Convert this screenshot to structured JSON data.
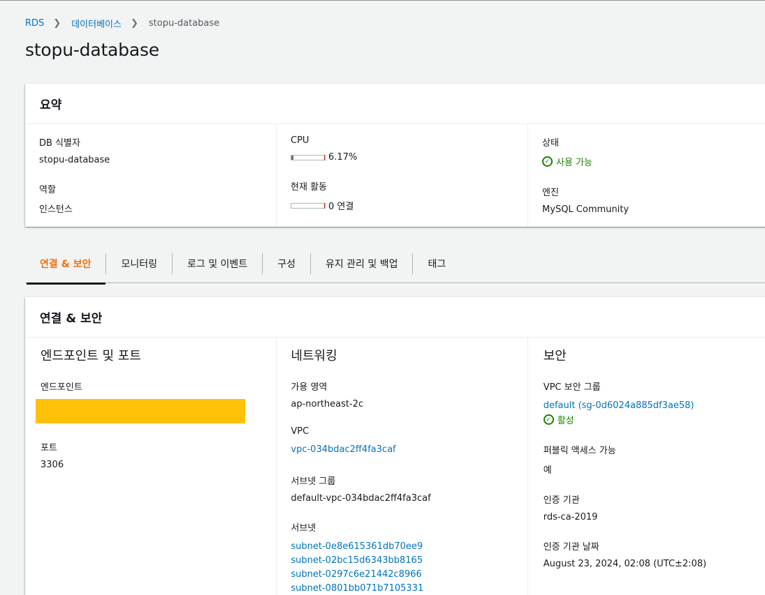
{
  "breadcrumb": {
    "rds": "RDS",
    "databases": "데이터베이스",
    "current": "stopu-database"
  },
  "page_title": "stopu-database",
  "summary": {
    "title": "요약",
    "db_id_label": "DB 식별자",
    "db_id_value": "stopu-database",
    "role_label": "역할",
    "role_value": "인스턴스",
    "cpu_label": "CPU",
    "cpu_value": "6.17%",
    "cpu_fraction": 0.0617,
    "activity_label": "현재 활동",
    "activity_value": "0 연결",
    "status_label": "상태",
    "status_value": "사용 가능",
    "engine_label": "엔진",
    "engine_value": "MySQL Community"
  },
  "tabs": [
    "연결 & 보안",
    "모니터링",
    "로그 및 이벤트",
    "구성",
    "유지 관리 및 백업",
    "태그"
  ],
  "connectivity": {
    "title": "연결 & 보안",
    "endpoint_section": "엔드포인트 및 포트",
    "endpoint_label": "엔드포인트",
    "port_label": "포트",
    "port_value": "3306",
    "networking_section": "네트워킹",
    "az_label": "가용 영역",
    "az_value": "ap-northeast-2c",
    "vpc_label": "VPC",
    "vpc_value": "vpc-034bdac2ff4fa3caf",
    "subnet_group_label": "서브넷 그룹",
    "subnet_group_value": "default-vpc-034bdac2ff4fa3caf",
    "subnets_label": "서브넷",
    "subnets": [
      "subnet-0e8e615361db70ee9",
      "subnet-02bc15d6343bb8165",
      "subnet-0297c6e21442c8966",
      "subnet-0801bb071b7105331"
    ],
    "security_section": "보안",
    "sg_label": "VPC 보안 그룹",
    "sg_value": "default (sg-0d6024a885df3ae58)",
    "sg_status": "활성",
    "public_label": "퍼블릭 액세스 가능",
    "public_value": "예",
    "ca_label": "인증 기관",
    "ca_value": "rds-ca-2019",
    "ca_date_label": "인증 기관 날짜",
    "ca_date_value": "August 23, 2024, 02:08 (UTC±2:08)"
  },
  "colors": {
    "link": "#0073bb",
    "active_tab": "#ec7211",
    "success": "#1d8102",
    "redaction": "#ffc107"
  }
}
